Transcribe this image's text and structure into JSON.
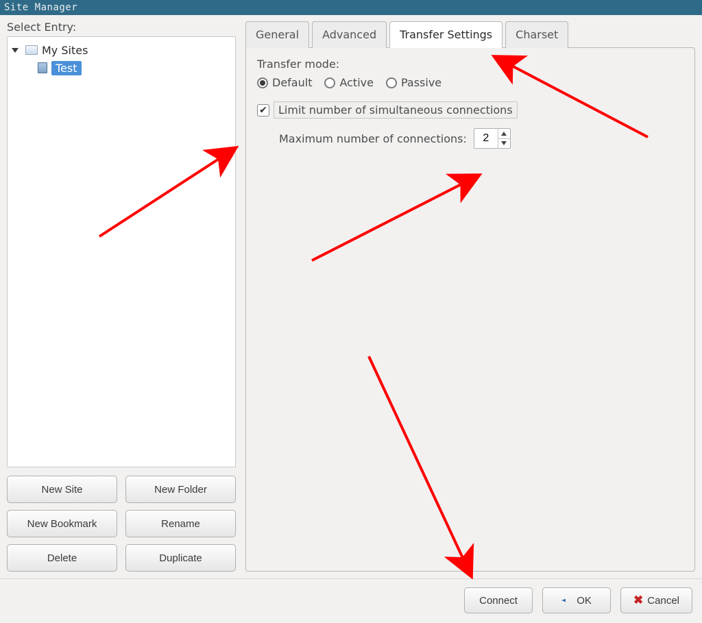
{
  "window": {
    "title": "Site Manager"
  },
  "left": {
    "label": "Select Entry:",
    "tree": {
      "root": "My Sites",
      "site": "Test"
    },
    "buttons": {
      "new_site": "New Site",
      "new_folder": "New Folder",
      "new_bookmark": "New Bookmark",
      "rename": "Rename",
      "delete": "Delete",
      "duplicate": "Duplicate"
    }
  },
  "tabs": {
    "general": "General",
    "advanced": "Advanced",
    "transfer_settings": "Transfer Settings",
    "charset": "Charset"
  },
  "transfer": {
    "mode_label": "Transfer mode:",
    "mode": {
      "default": "Default",
      "active": "Active",
      "passive": "Passive",
      "selected": "default"
    },
    "limit_checkbox": {
      "label": "Limit number of simultaneous connections",
      "checked": true
    },
    "max_conn_label": "Maximum number of connections:",
    "max_conn_value": "2"
  },
  "bottom": {
    "connect": "Connect",
    "ok": "OK",
    "cancel": "Cancel"
  }
}
